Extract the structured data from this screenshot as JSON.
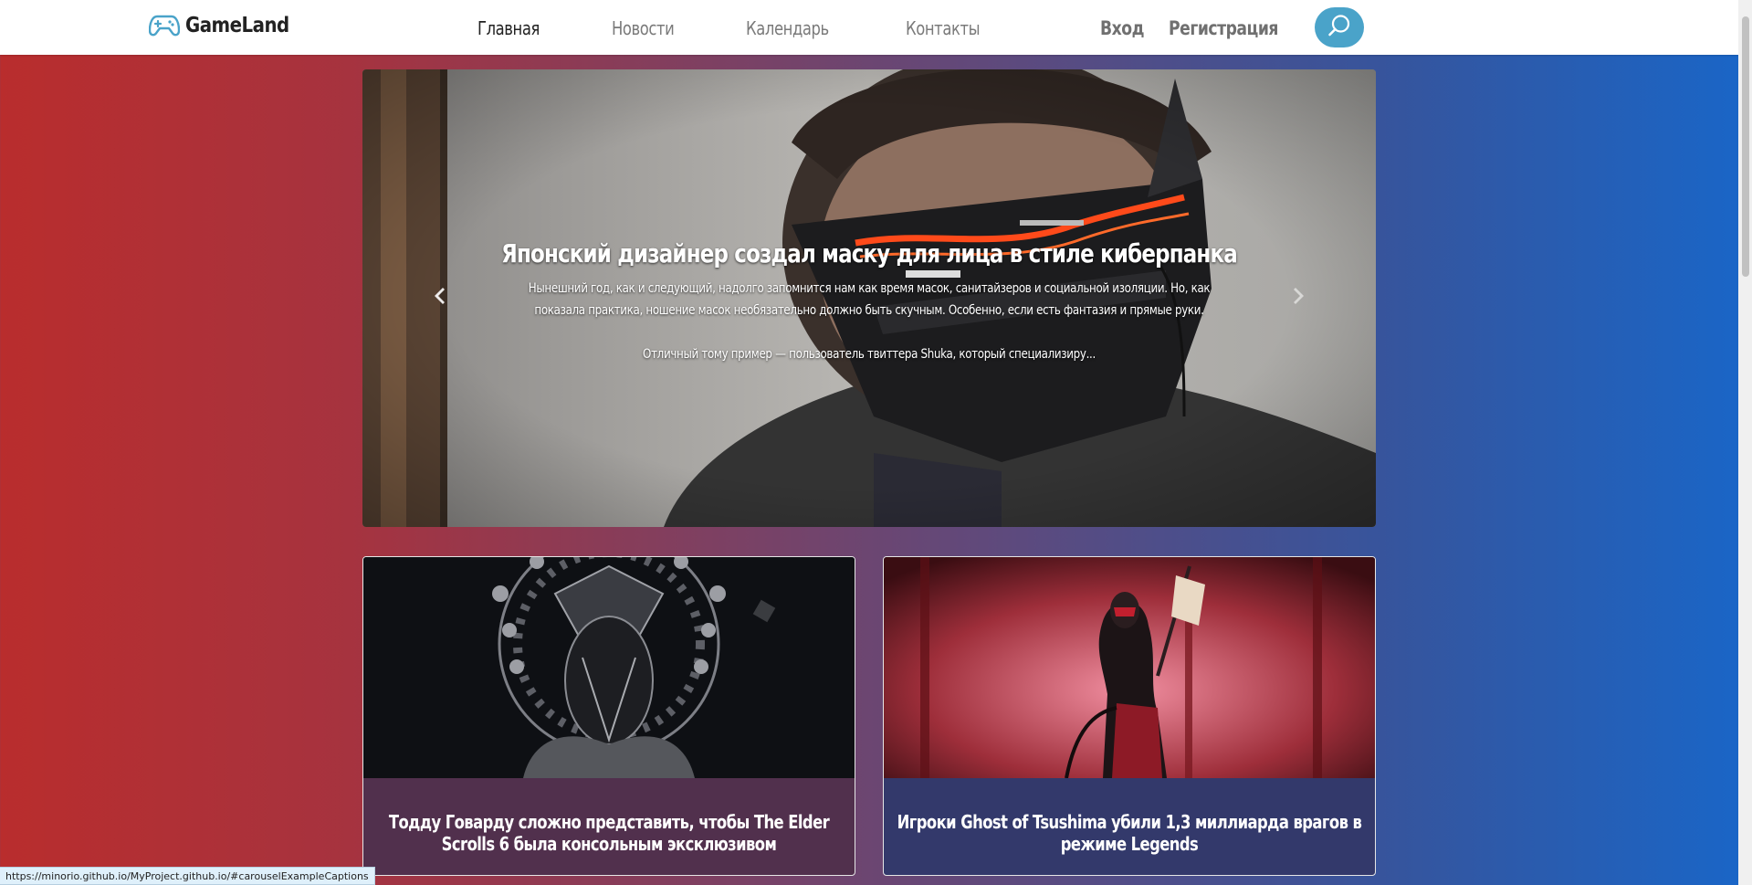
{
  "brand": {
    "name": "GameLand",
    "icon": "gamepad-icon"
  },
  "nav": {
    "items": [
      {
        "label": "Главная",
        "active": true
      },
      {
        "label": "Новости",
        "active": false
      },
      {
        "label": "Календарь",
        "active": false
      },
      {
        "label": "Контакты",
        "active": false
      }
    ]
  },
  "auth": {
    "login_label": "Вход",
    "register_label": "Регистрация"
  },
  "search": {
    "icon": "search-icon",
    "color": "#4aa3c9"
  },
  "carousel": {
    "slide": {
      "title": "Японский дизайнер создал маску для лица в стиле киберпанка",
      "paragraph1": "Нынешний год, как и следующий, надолго запомнится нам как время масок, санитайзеров и социальной изоляции. Но, как показала практика, ношение масок необязательно должно быть скучным. Особенно, если есть фантазия и прямые руки.",
      "paragraph2": "Отличный тому пример — пользователь твиттера Shuka, который специализиру..."
    },
    "prev_icon": "chevron-left-icon",
    "next_icon": "chevron-right-icon"
  },
  "cards": [
    {
      "title": "Тодду Говарду сложно представить, чтобы The Elder Scrolls 6 была консольным эксклюзивом"
    },
    {
      "title": "Игроки Ghost of Tsushima убили 1,3 миллиарда врагов в режиме Legends"
    }
  ],
  "status_bar": {
    "url": "https://minorio.github.io/MyProject.github.io/#carouselExampleCaptions"
  },
  "colors": {
    "gradient_left": "#b92d2d",
    "gradient_right": "#1966c8",
    "header_bg": "#ffffff"
  }
}
